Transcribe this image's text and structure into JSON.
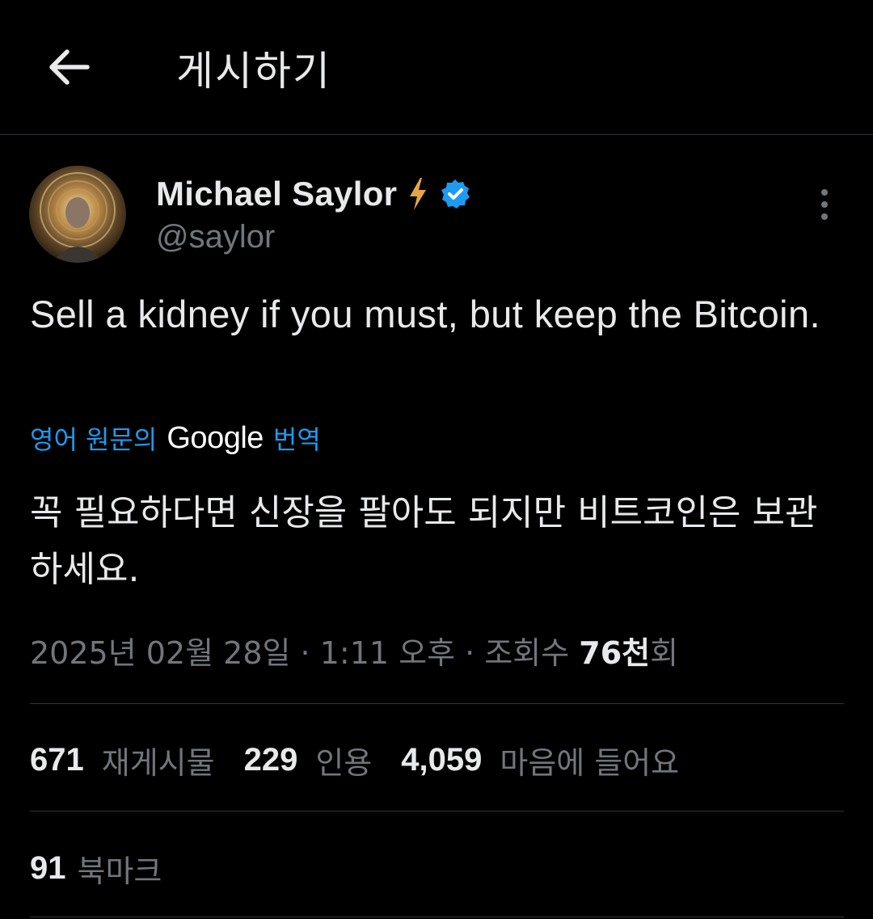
{
  "header": {
    "title": "게시하기",
    "back_icon": "arrow-left-icon"
  },
  "author": {
    "display_name": "Michael Saylor",
    "handle": "@saylor",
    "badges": [
      "lightning-emoji-icon",
      "verified-badge-icon"
    ],
    "verified_color": "#1d9bf0"
  },
  "tweet": {
    "text": "Sell a kidney if you must, but keep the Bitcoin.",
    "translate_prefix": "영어 원문의",
    "translate_brand": "Google",
    "translate_suffix": "번역",
    "translated_text": "꼭 필요하다면 신장을 팔아도 되지만 비트코인은 보관하세요.",
    "date": "2025년 02월 28일",
    "separator": "·",
    "time": "1:11 오후",
    "views_label": "조회수",
    "views_count": "76천",
    "views_suffix": "회"
  },
  "stats": {
    "reposts_count": "671",
    "reposts_label": "재게시물",
    "quotes_count": "229",
    "quotes_label": "인용",
    "likes_count": "4,059",
    "likes_label": "마음에 들어요",
    "bookmarks_count": "91",
    "bookmarks_label": "북마크"
  },
  "colors": {
    "background": "#000000",
    "text_primary": "#e7e9ea",
    "text_secondary": "#71767b",
    "accent": "#1d9bf0",
    "divider": "#2f3336"
  }
}
